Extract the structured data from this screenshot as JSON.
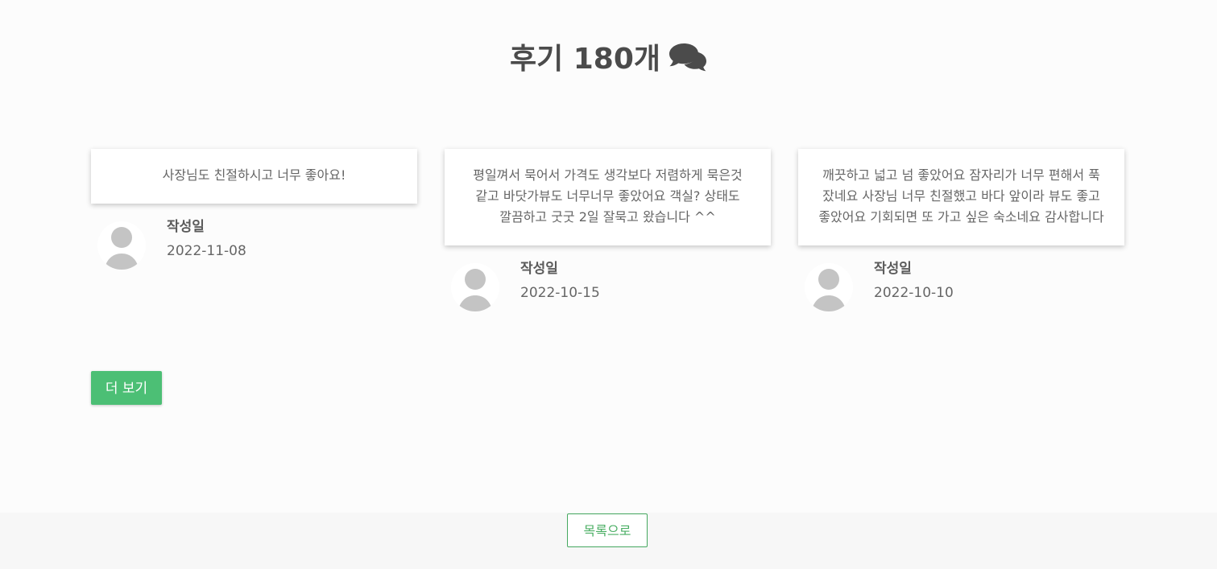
{
  "header": {
    "title": "후기 180개",
    "icon": "comments-icon"
  },
  "reviews": [
    {
      "text": "사장님도 친절하시고 너무 좋아요!",
      "author_label": "작성일",
      "date": "2022-11-08",
      "avatar_icon": "user-avatar-icon"
    },
    {
      "text": "평일껴서 묵어서 가격도 생각보다 저렴하게 묵은것 같고 바닷가뷰도 너무너무 좋았어요 객실? 상태도 깔끔하고 굿굿 2일 잘묵고 왔습니다 ^^",
      "author_label": "작성일",
      "date": "2022-10-15",
      "avatar_icon": "user-avatar-icon"
    },
    {
      "text": "깨끗하고 넓고 넘 좋았어요 잠자리가 너무 편해서 푹 잤네요 사장님 너무 친절했고 바다 앞이라 뷰도 좋고 좋았어요 기회되면 또 가고 싶은 숙소네요 감사합니다",
      "author_label": "작성일",
      "date": "2022-10-10",
      "avatar_icon": "user-avatar-icon"
    }
  ],
  "actions": {
    "more_label": "더 보기",
    "back_label": "목록으로"
  },
  "colors": {
    "accent": "#4cbf75",
    "back_border": "#45a85f",
    "text": "#5a5a5a",
    "background": "#fcfcfc"
  }
}
